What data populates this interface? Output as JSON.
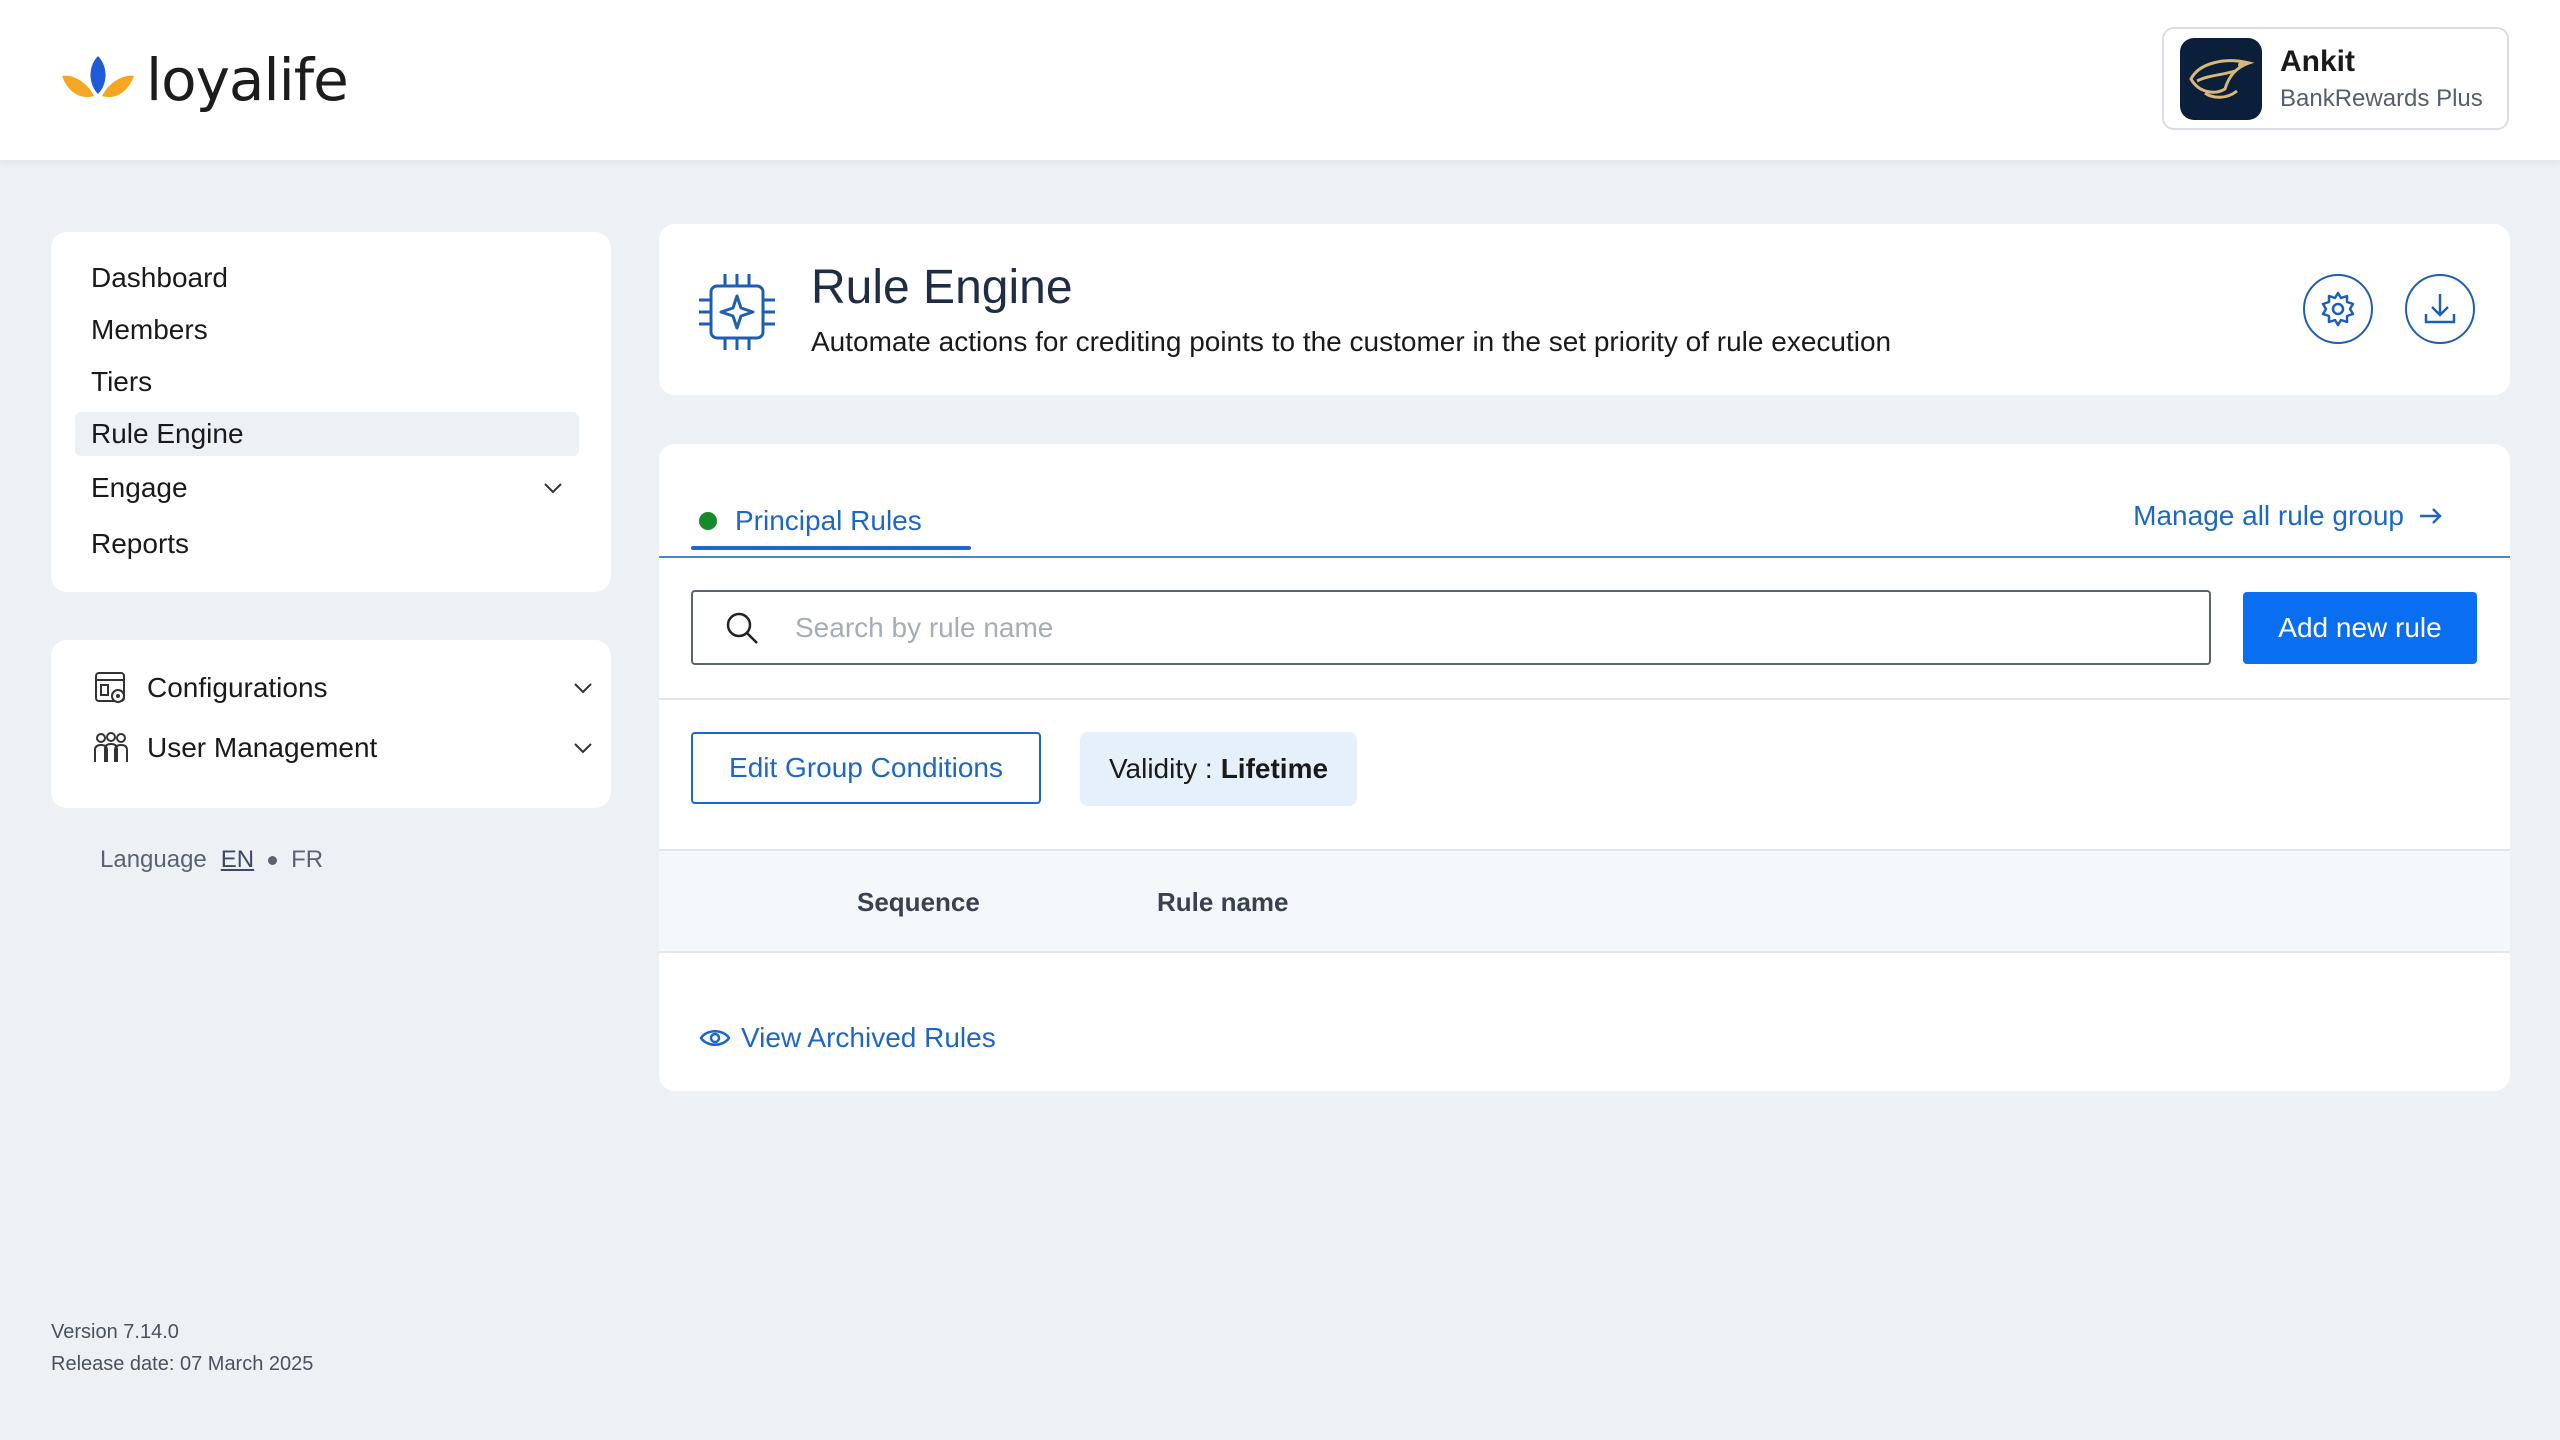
{
  "brand": {
    "name": "loyalife"
  },
  "user": {
    "name": "Ankit",
    "program": "BankRewards Plus"
  },
  "nav": {
    "items": [
      {
        "label": "Dashboard",
        "active": false
      },
      {
        "label": "Members",
        "active": false
      },
      {
        "label": "Tiers",
        "active": false
      },
      {
        "label": "Rule Engine",
        "active": true
      },
      {
        "label": "Engage",
        "active": false,
        "expandable": true
      },
      {
        "label": "Reports",
        "active": false
      }
    ],
    "admin": [
      {
        "label": "Configurations",
        "icon": "configurations-icon"
      },
      {
        "label": "User Management",
        "icon": "users-icon"
      }
    ]
  },
  "language": {
    "label": "Language",
    "options": [
      "EN",
      "FR"
    ],
    "selected": "EN"
  },
  "version": {
    "version": "Version 7.14.0",
    "release": "Release date: 07 March 2025"
  },
  "page": {
    "title": "Rule Engine",
    "subtitle": "Automate actions for crediting points to the customer in the set priority of rule execution",
    "actions": [
      "settings-icon",
      "download-icon"
    ]
  },
  "rules": {
    "tab": "Principal Rules",
    "manage_link": "Manage all rule group",
    "search_placeholder": "Search by rule name",
    "add_button": "Add new rule",
    "edit_button": "Edit Group Conditions",
    "validity_label": "Validity :",
    "validity_value": "Lifetime",
    "columns": [
      "Sequence",
      "Rule name"
    ],
    "archived_link": "View Archived Rules"
  },
  "colors": {
    "primary": "#0a6ef0",
    "link": "#1e67c4",
    "status_active": "#158a2b",
    "background": "#edf1f5"
  }
}
